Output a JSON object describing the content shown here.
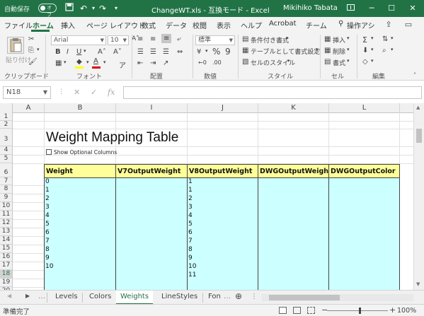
{
  "titlebar": {
    "autosave_label": "自動保存",
    "autosave_state": "オフ",
    "window_title": "ChangeWT.xls  -  互換モード  -  Excel",
    "user": "Mikihiko Tabata",
    "accent": "#217346"
  },
  "tabs": {
    "items": [
      "ファイル",
      "ホーム",
      "挿入",
      "ページ レイアウト",
      "数式",
      "データ",
      "校閲",
      "表示",
      "ヘルプ",
      "Acrobat",
      "チーム",
      "操作アシ"
    ],
    "active": "ホーム"
  },
  "ribbon": {
    "groups": [
      "クリップボード",
      "フォント",
      "配置",
      "数値",
      "スタイル",
      "セル",
      "編集"
    ],
    "paste_label": "貼り付け",
    "font_name": "Arial",
    "font_size": "10",
    "number_format": "標準",
    "styles": {
      "conditional": "条件付き書式",
      "table": "テーブルとして書式設定",
      "cell_styles": "セルのスタイル"
    },
    "cells": {
      "insert": "挿入",
      "delete": "削除",
      "format": "書式"
    }
  },
  "formula_bar": {
    "name_box": "N18",
    "fx_label": "fx",
    "formula": ""
  },
  "grid": {
    "columns": [
      "A",
      "B",
      "I",
      "J",
      "K",
      "L"
    ],
    "rows": [
      "1",
      "2",
      "3",
      "4",
      "5",
      "6",
      "7",
      "8",
      "9",
      "10",
      "11",
      "12",
      "13",
      "14",
      "15",
      "16",
      "17",
      "18",
      "19",
      "20"
    ],
    "selected_row": "18",
    "sheet_title": "Weight Mapping Table",
    "checkbox_label": "Show Optional Columns",
    "headers": [
      "Weight",
      "V7OutputWeight",
      "V8OutputWeight",
      "DWGOutputWeight",
      "DWGOutputColor"
    ],
    "weight_values": [
      "0",
      "1",
      "2",
      "3",
      "4",
      "5",
      "6",
      "7",
      "8",
      "9",
      "10"
    ],
    "v8_values": [
      "1",
      "1",
      "2",
      "3",
      "4",
      "5",
      "6",
      "7",
      "8",
      "9",
      "10",
      "11"
    ]
  },
  "sheet_tabs": {
    "items": [
      "Levels",
      "Colors",
      "Weights",
      "LineStyles",
      "Fon"
    ],
    "active": "Weights"
  },
  "status": {
    "ready": "準備完了",
    "zoom": "100%"
  }
}
